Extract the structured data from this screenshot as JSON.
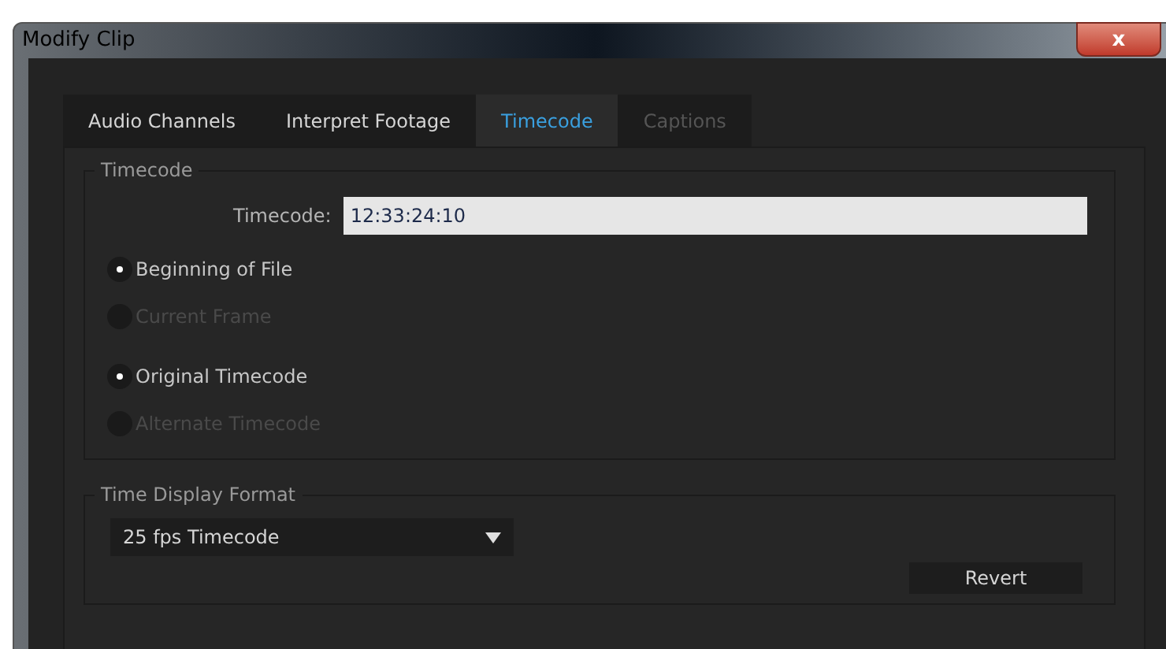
{
  "window": {
    "title": "Modify Clip",
    "close_label": "x"
  },
  "tabs": [
    {
      "label": "Audio Channels",
      "selected": false,
      "disabled": false
    },
    {
      "label": "Interpret Footage",
      "selected": false,
      "disabled": false
    },
    {
      "label": "Timecode",
      "selected": true,
      "disabled": false
    },
    {
      "label": "Captions",
      "selected": false,
      "disabled": true
    }
  ],
  "timecode_group": {
    "title": "Timecode",
    "field_label": "Timecode:",
    "value": "12:33:24:10",
    "radio_groups": [
      [
        {
          "label": "Beginning of File",
          "selected": true,
          "disabled": false
        },
        {
          "label": "Current Frame",
          "selected": false,
          "disabled": true
        }
      ],
      [
        {
          "label": "Original Timecode",
          "selected": true,
          "disabled": false
        },
        {
          "label": "Alternate Timecode",
          "selected": false,
          "disabled": true
        }
      ]
    ]
  },
  "format_group": {
    "title": "Time Display Format",
    "dropdown": "25 fps Timecode"
  },
  "buttons": [
    "Revert"
  ]
}
